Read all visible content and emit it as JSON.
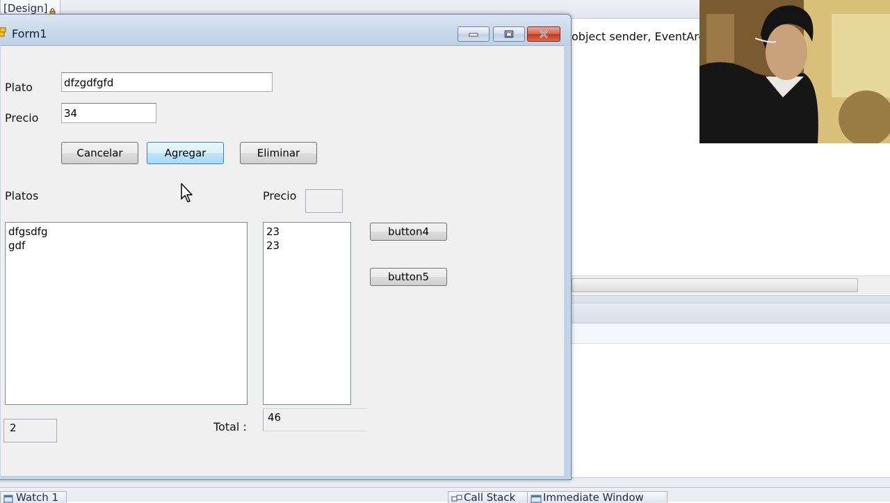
{
  "ide": {
    "design_tab_label": "[Design]",
    "code_line": "object sender, EventArg",
    "bottom_tabs": {
      "watch": "Watch 1",
      "call_stack": "Call Stack",
      "immediate": "Immediate Window"
    }
  },
  "form": {
    "title": "Form1",
    "plato_label": "Plato",
    "plato_value": "dfzgdfgfd",
    "precio_label": "Precio",
    "precio_value": "34",
    "cancelar_button": "Cancelar",
    "agregar_button": "Agregar",
    "eliminar_button": "Eliminar",
    "platos_label": "Platos",
    "precio_list_label": "Precio",
    "precio_small_box": "",
    "platos_list": [
      "dfgsdfg",
      "gdf"
    ],
    "precios_list": [
      "23",
      "23"
    ],
    "button4": "button4",
    "button5": "button5",
    "count_value": "2",
    "total_label": "Total :",
    "total_value": "46"
  },
  "colors": {
    "window_frame": "#c3d4e8",
    "client_bg": "#f0f0f0",
    "close_button": "#c2391f",
    "hot_button": "#bee6fd"
  }
}
